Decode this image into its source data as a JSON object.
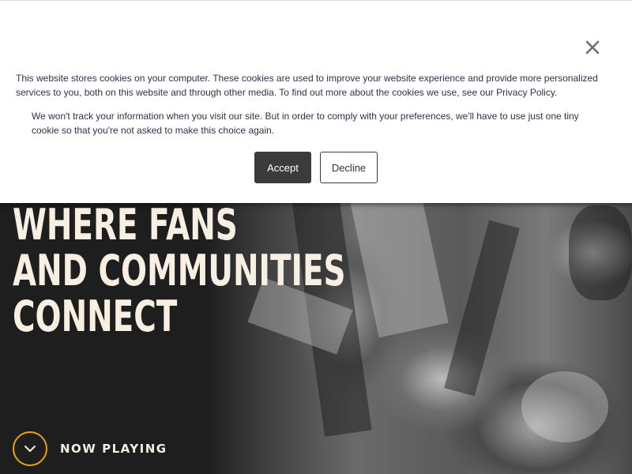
{
  "cookie_banner": {
    "message": "This website stores cookies on your computer. These cookies are used to improve your website experience and provide more personalized services to you, both on this website and through other media. To find out more about the cookies we use, see our Privacy Policy.",
    "notice": "We won't track your information when you visit our site. But in order to comply with your preferences, we'll have to use just one tiny cookie so that you're not asked to make this choice again.",
    "accept_label": "Accept",
    "decline_label": "Decline",
    "close_icon": "close-icon"
  },
  "hero": {
    "headline_lines": [
      "WHERE FANS",
      "AND COMMUNITIES",
      "CONNECT"
    ],
    "now_playing_label": "NOW PLAYING",
    "now_playing_icon": "chevron-down-icon"
  },
  "colors": {
    "accent": "#e8a21a",
    "headline": "#f6efe2",
    "hero_background": "#1e1e1e",
    "accept_button": "#3b3b3b"
  }
}
